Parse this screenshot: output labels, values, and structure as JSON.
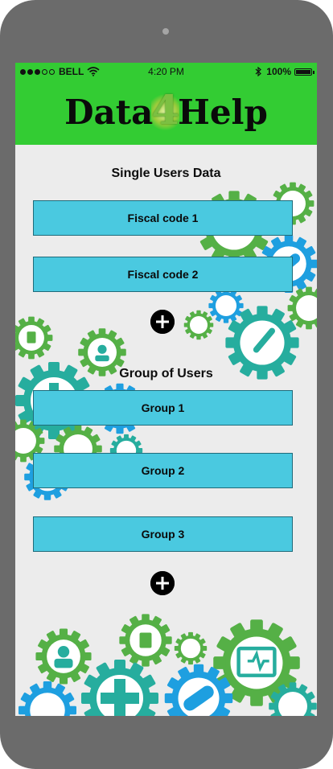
{
  "status_bar": {
    "carrier": "BELL",
    "time": "4:20 PM",
    "battery_percent": "100%",
    "signal_bars_filled": 3,
    "signal_bars_total": 5
  },
  "header": {
    "logo_part1": "Data",
    "logo_part2": "4",
    "logo_part3": "Help",
    "background_color": "#33cc33"
  },
  "single_users": {
    "title": "Single Users Data",
    "items": [
      {
        "label": "Fiscal code 1"
      },
      {
        "label": "Fiscal code 2"
      }
    ],
    "add_icon": "plus-circle-icon"
  },
  "group_users": {
    "title": "Group of Users",
    "items": [
      {
        "label": "Group 1"
      },
      {
        "label": "Group 2"
      },
      {
        "label": "Group 3"
      }
    ],
    "add_icon": "plus-circle-icon"
  },
  "colors": {
    "button_fill": "#4ac9e0",
    "button_border": "#1f6b7a",
    "gear_green": "#55b046",
    "gear_teal": "#26ad9e",
    "gear_blue": "#1e9fe0"
  }
}
